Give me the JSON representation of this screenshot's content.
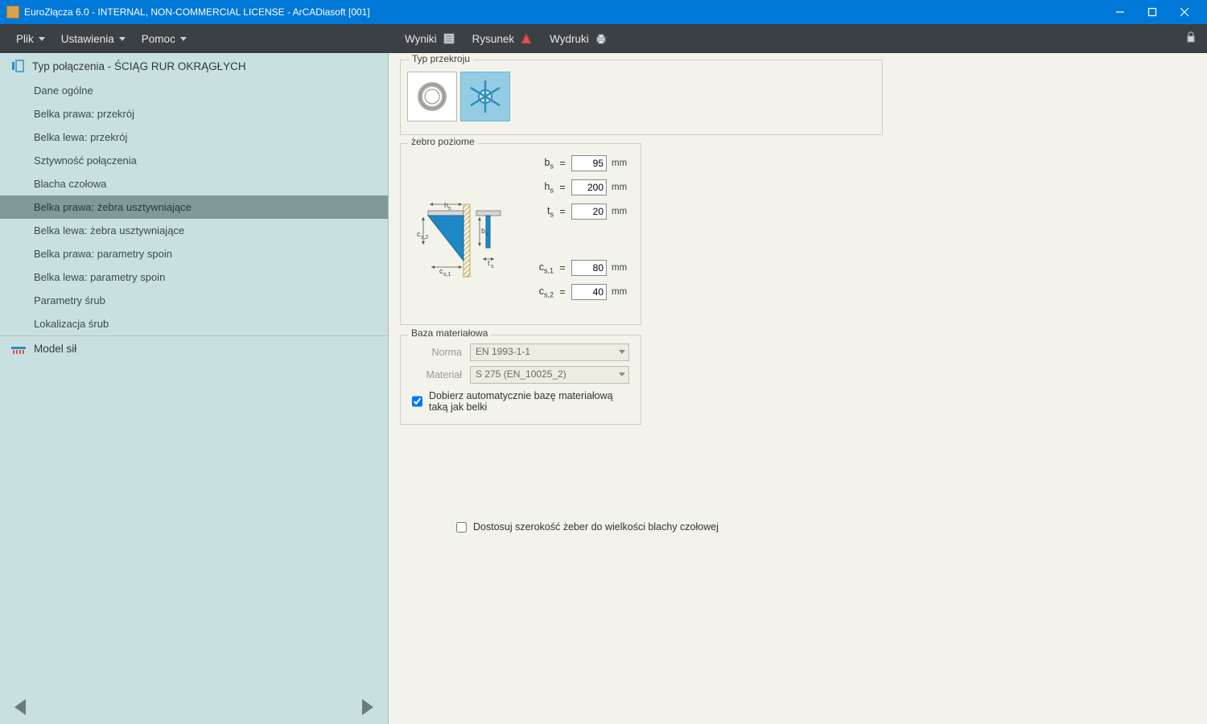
{
  "window": {
    "title": "EuroZłącza 6.0 - INTERNAL, NON-COMMERCIAL LICENSE - ArCADiasoft [001]"
  },
  "menu_left": {
    "plik": "Plik",
    "ustawienia": "Ustawienia",
    "pomoc": "Pomoc"
  },
  "menu_right": {
    "wyniki": "Wyniki",
    "rysunek": "Rysunek",
    "wydruki": "Wydruki"
  },
  "sidebar": {
    "header": "Typ połączenia - ŚCIĄG RUR OKRĄGŁYCH",
    "items": [
      "Dane ogólne",
      "Belka prawa: przekrój",
      "Belka lewa: przekrój",
      "Sztywność połączenia",
      "Blacha czołowa",
      "Belka prawa: żebra usztywniające",
      "Belka lewa: żebra usztywniające",
      "Belka prawa: parametry spoin",
      "Belka lewa: parametry spoin",
      "Parametry śrub",
      "Lokalizacja śrub"
    ],
    "selected_index": 5,
    "model_sil": "Model sił"
  },
  "panel": {
    "typ_przekroju_legend": "Typ przekroju",
    "zebro_legend": "żebro poziome",
    "params": {
      "bs": {
        "label_html": "b<sub>s</sub>",
        "value": "95",
        "unit": "mm"
      },
      "hs": {
        "label_html": "h<sub>s</sub>",
        "value": "200",
        "unit": "mm"
      },
      "ts": {
        "label_html": "t<sub>s</sub>",
        "value": "20",
        "unit": "mm"
      },
      "cs1": {
        "label_html": "c<sub>s,1</sub>",
        "value": "80",
        "unit": "mm"
      },
      "cs2": {
        "label_html": "c<sub>s,2</sub>",
        "value": "40",
        "unit": "mm"
      }
    },
    "baza_legend": "Baza materiałowa",
    "norma_label": "Norma",
    "norma_value": "EN 1993-1-1",
    "material_label": "Materiał",
    "material_value": "S 275 (EN_10025_2)",
    "auto_checkbox": "Dobierz automatycznie bazę materiałową taką jak belki",
    "bottom_checkbox": "Dostosuj szerokość żeber do wielkości blachy czołowej"
  }
}
